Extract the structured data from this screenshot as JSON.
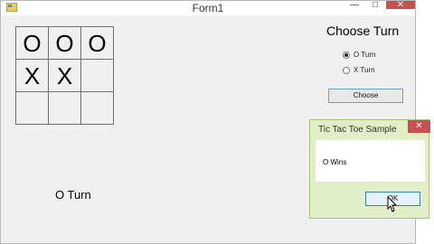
{
  "window": {
    "title": "Form1",
    "min_glyph": "—",
    "max_glyph": "□",
    "close_glyph": "✕"
  },
  "board": {
    "cells": [
      "O",
      "O",
      "O",
      "X",
      "X",
      "",
      "",
      "",
      ""
    ]
  },
  "choose": {
    "title": "Choose Turn",
    "options": [
      {
        "label": "O Turn",
        "checked": true
      },
      {
        "label": "X Turn",
        "checked": false
      }
    ],
    "button_label": "Choose"
  },
  "status": {
    "label": "O Turn"
  },
  "dialog": {
    "title": "Tic Tac Toe Sample",
    "close_glyph": "✕",
    "message": "O Wins",
    "ok_label": "OK"
  },
  "colors": {
    "close_red": "#c75050",
    "dialog_frame": "#e1eec8",
    "button_focus": "#3c7fb1"
  }
}
